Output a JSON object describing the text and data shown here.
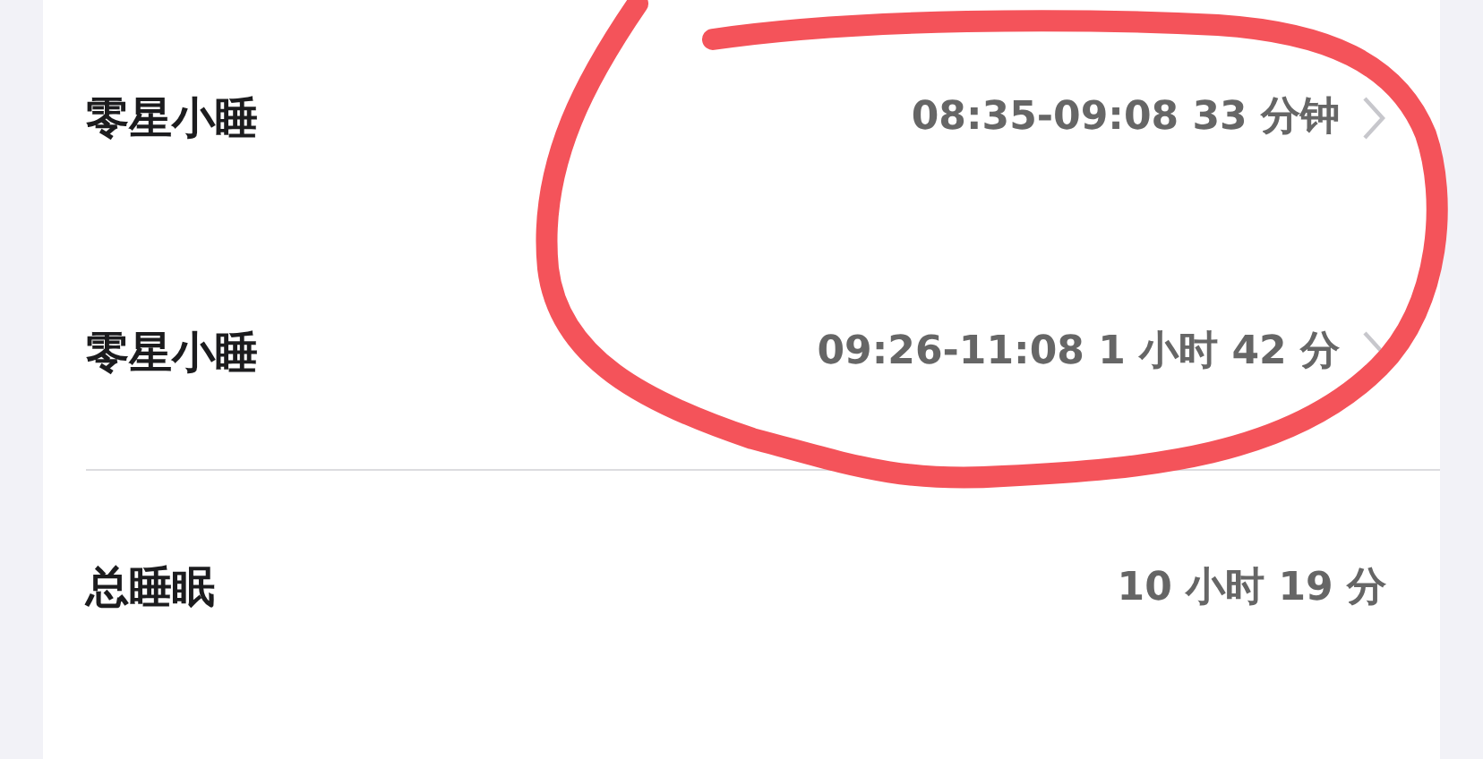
{
  "rows": [
    {
      "kind": "link",
      "label": "零星小睡",
      "value": "08:35-09:08 33 分钟"
    },
    {
      "kind": "link",
      "label": "零星小睡",
      "value": "09:26-11:08 1 小时 42 分"
    },
    {
      "kind": "plain",
      "label": "总睡眠",
      "value": "10 小时 19 分"
    }
  ]
}
